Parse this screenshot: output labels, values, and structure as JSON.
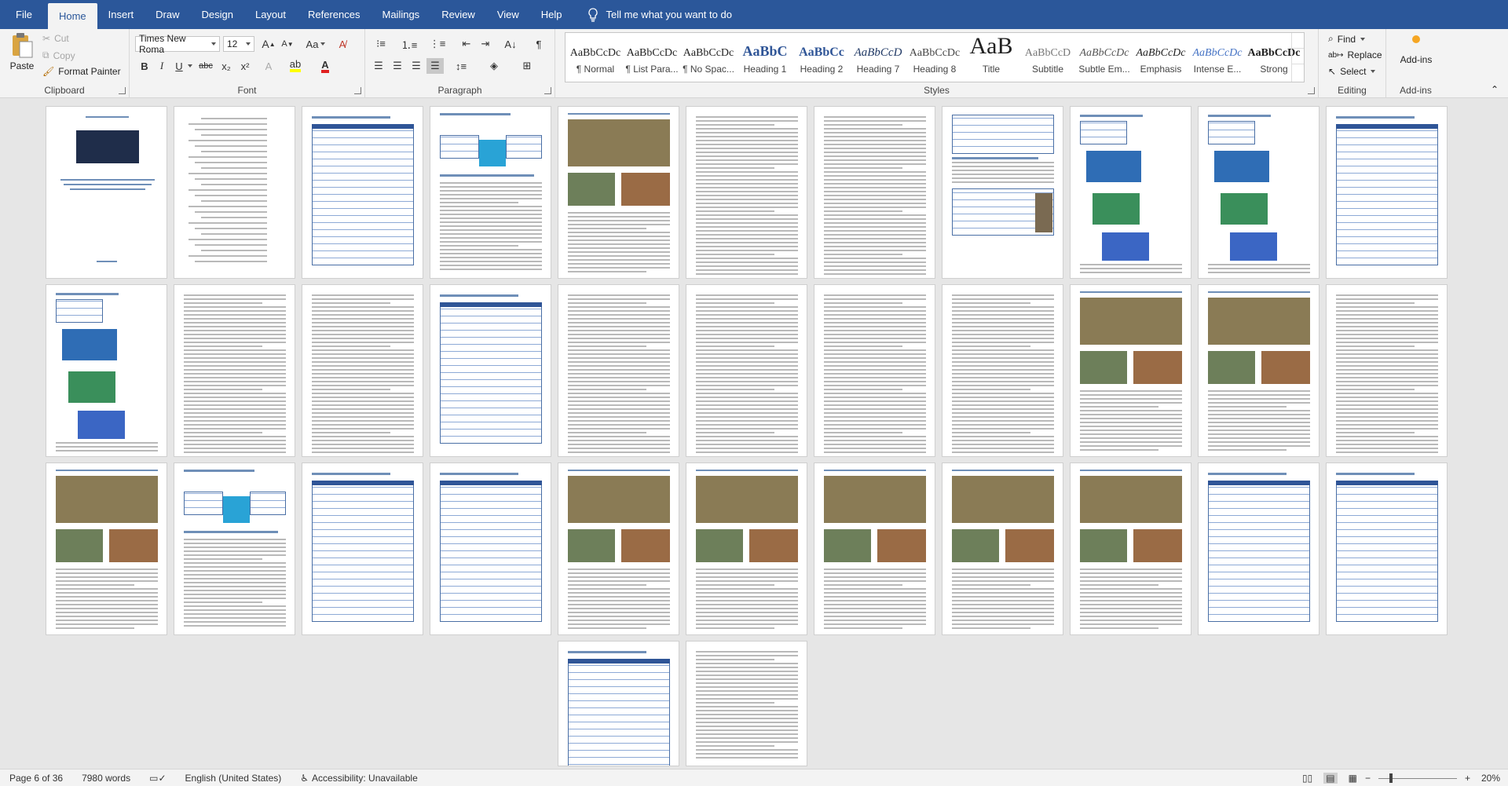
{
  "tabs": [
    "File",
    "Home",
    "Insert",
    "Draw",
    "Design",
    "Layout",
    "References",
    "Mailings",
    "Review",
    "View",
    "Help"
  ],
  "active_tab": "Home",
  "tell_me": "Tell me what you want to do",
  "clipboard": {
    "paste": "Paste",
    "cut": "Cut",
    "copy": "Copy",
    "format_painter": "Format Painter",
    "label": "Clipboard"
  },
  "font": {
    "name": "Times New Roma",
    "size": "12",
    "label": "Font",
    "bold": "B",
    "italic": "I",
    "underline": "U",
    "strike": "abc",
    "sub": "x₂",
    "sup": "x²",
    "grow": "A",
    "shrink": "A",
    "case": "Aa"
  },
  "paragraph": {
    "label": "Paragraph"
  },
  "styles": {
    "label": "Styles",
    "items": [
      {
        "preview": "AaBbCcDc",
        "name": "¶ Normal"
      },
      {
        "preview": "AaBbCcDc",
        "name": "¶ List Para..."
      },
      {
        "preview": "AaBbCcDc",
        "name": "¶ No Spac..."
      },
      {
        "preview": "AaBbC",
        "name": "Heading 1"
      },
      {
        "preview": "AaBbCc",
        "name": "Heading 2"
      },
      {
        "preview": "AaBbCcD",
        "name": "Heading 7"
      },
      {
        "preview": "AaBbCcDc",
        "name": "Heading 8"
      },
      {
        "preview": "AaB",
        "name": "Title"
      },
      {
        "preview": "AaBbCcD",
        "name": "Subtitle"
      },
      {
        "preview": "AaBbCcDc",
        "name": "Subtle Em..."
      },
      {
        "preview": "AaBbCcDc",
        "name": "Emphasis"
      },
      {
        "preview": "AaBbCcDc",
        "name": "Intense E..."
      },
      {
        "preview": "AaBbCcDc",
        "name": "Strong"
      }
    ]
  },
  "editing": {
    "find": "Find",
    "replace": "Replace",
    "select": "Select",
    "label": "Editing"
  },
  "addins": {
    "button": "Add-ins",
    "label": "Add-ins"
  },
  "status": {
    "page": "Page 6 of 36",
    "words": "7980 words",
    "language": "English (United States)",
    "accessibility": "Accessibility: Unavailable",
    "zoom": "20%"
  },
  "colors": {
    "brand": "#2b579a",
    "ribbon": "#f3f3f3",
    "canvas": "#e6e6e6"
  }
}
